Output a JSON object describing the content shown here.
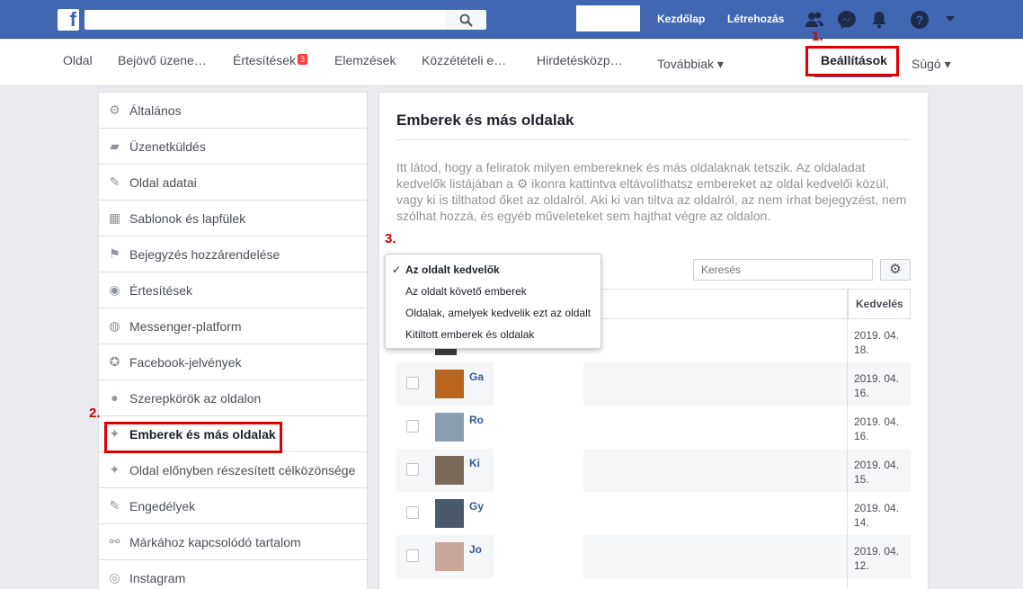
{
  "topbar": {
    "logo": "f",
    "search_placeholder": "",
    "links": [
      "Kezdőlap",
      "Létrehozás"
    ],
    "icons": [
      "friends-icon",
      "messenger-icon",
      "notifications-icon",
      "help-icon",
      "menu-caret-icon"
    ]
  },
  "pagenav": {
    "items": [
      {
        "label": "Oldal"
      },
      {
        "label": "Bejövő üzene…"
      },
      {
        "label": "Értesítések",
        "badge": "3"
      },
      {
        "label": "Elemzések"
      },
      {
        "label": "Közzétételi e…"
      },
      {
        "label": "Hirdetésközp…"
      },
      {
        "label": "Továbbiak ▾"
      }
    ],
    "active": "Beállítások",
    "help": "Súgó ▾"
  },
  "markers": {
    "one": "1.",
    "two": "2.",
    "three": "3."
  },
  "sidebar": {
    "items": [
      {
        "label": "Általános",
        "icon": "⚙"
      },
      {
        "label": "Üzenetküldés",
        "icon": "▰"
      },
      {
        "label": "Oldal adatai",
        "icon": "✎"
      },
      {
        "label": "Sablonok és lapfülek",
        "icon": "▦"
      },
      {
        "label": "Bejegyzés hozzárendelése",
        "icon": "⚑"
      },
      {
        "label": "Értesítések",
        "icon": "◉"
      },
      {
        "label": "Messenger-platform",
        "icon": "◍"
      },
      {
        "label": "Facebook-jelvények",
        "icon": "✪"
      },
      {
        "label": "Szerepkörök az oldalon",
        "icon": "●"
      },
      {
        "label": "Emberek és más oldalak",
        "icon": "✦"
      },
      {
        "label": "Oldal előnyben részesített célközönsége",
        "icon": "✦"
      },
      {
        "label": "Engedélyek",
        "icon": "✎"
      },
      {
        "label": "Márkához kapcsolódó tartalom",
        "icon": "⚯"
      },
      {
        "label": "Instagram",
        "icon": "◎"
      }
    ]
  },
  "main": {
    "title": "Emberek és más oldalak",
    "description": "Itt látod, hogy a                              feliratok milyen embereknek és más oldalaknak tetszik. Az oldaladat kedvelők listájában a ⚙ ikonra kattintva eltávolíthatsz embereket az oldal kedvelői közül, vagy ki is tilthatod őket az oldalról. Aki ki van tiltva az oldalról, az nem írhat bejegyzést, nem szólhat hozzá, és egyéb műveleteket sem hajthat végre az oldalon.",
    "search_placeholder": "Keresés",
    "column_likes": "Kedvelés",
    "dropdown": [
      {
        "label": "Az oldalt kedvelők",
        "checked": true
      },
      {
        "label": "Az oldalt követő emberek",
        "checked": false
      },
      {
        "label": "Oldalak, amelyek kedvelik ezt az oldalt",
        "checked": false
      },
      {
        "label": "Kitiltott emberek és oldalak",
        "checked": false
      }
    ],
    "rows": [
      {
        "name": "",
        "date": "2019. 04. 18.",
        "thumb": "#3a3a3a"
      },
      {
        "name": "Ga",
        "date": "2019. 04. 16.",
        "thumb": "#b8651f"
      },
      {
        "name": "Ro",
        "date": "2019. 04. 16.",
        "thumb": "#8aa0b0"
      },
      {
        "name": "Ki",
        "date": "2019. 04. 15.",
        "thumb": "#7a6a5a"
      },
      {
        "name": "Gy",
        "date": "2019. 04. 14.",
        "thumb": "#4a5a6a"
      },
      {
        "name": "Jo",
        "date": "2019. 04. 12.",
        "thumb": "#c9a79a"
      }
    ]
  },
  "colors": {
    "brand": "#4267b2",
    "highlight": "#e00000",
    "link": "#365899"
  }
}
